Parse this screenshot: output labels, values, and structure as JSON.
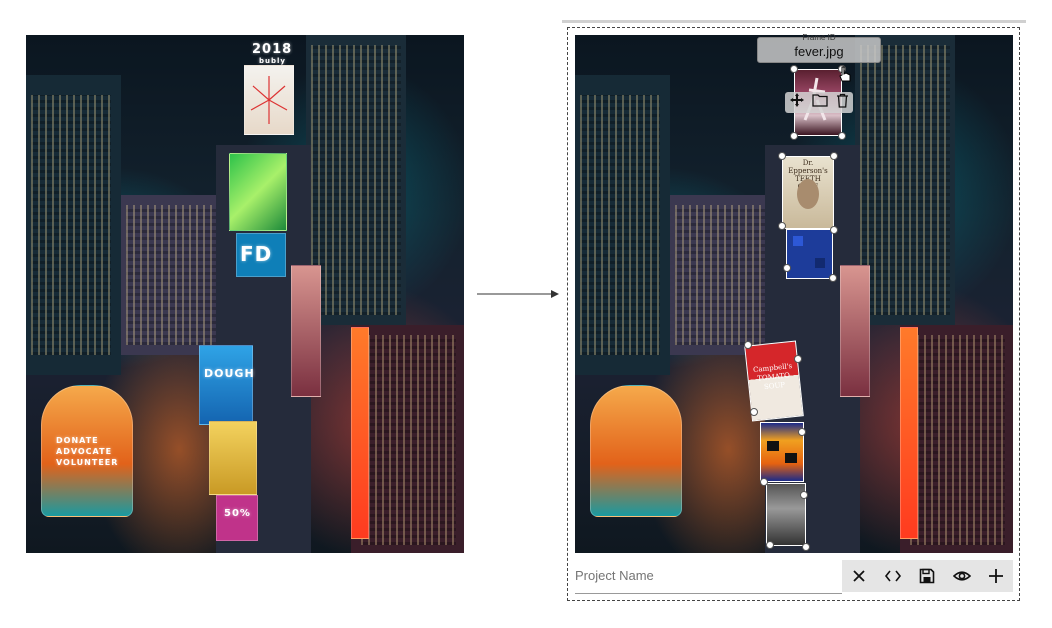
{
  "source_image": {
    "sign_year": "2018",
    "sign_brand": "bubly",
    "sign_fd": "FD",
    "sign_dough": "DOUGH",
    "sign_volunteer": "DONATE ADVOCATE VOLUNTEER",
    "sign_sale": "50%"
  },
  "editor": {
    "tooltip": {
      "label": "Frame ID",
      "value": "fever.jpg"
    },
    "frame_toolbar": {
      "icons": [
        "move-icon",
        "folder-icon",
        "trash-icon"
      ]
    },
    "frames": [
      {
        "name": "fever.jpg",
        "caption": ""
      },
      {
        "name": "teeth-glue",
        "caption": "Dr. Epperson's TEETH GLUE"
      },
      {
        "name": "pixel-blue",
        "caption": ""
      },
      {
        "name": "campbells-soup",
        "caption": "Campbell's TOMATO SOUP"
      },
      {
        "name": "pixel-orange",
        "caption": ""
      },
      {
        "name": "dark-painting",
        "caption": ""
      }
    ],
    "project_name": {
      "placeholder": "Project Name",
      "value": ""
    },
    "actions": [
      "close-icon",
      "code-icon",
      "save-icon",
      "eye-icon",
      "plus-icon"
    ]
  },
  "colors": {
    "handle": "#ffffff",
    "action_bar": "#e5e5e5"
  }
}
